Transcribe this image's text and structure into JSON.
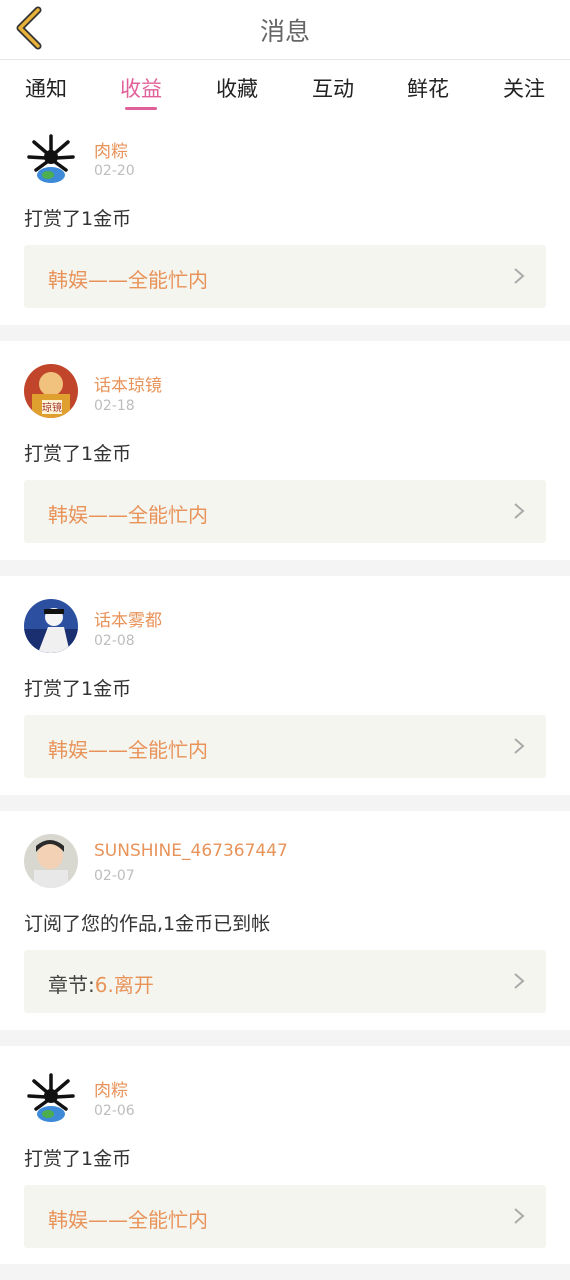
{
  "header": {
    "title": "消息",
    "back_icon": "chevron-left-icon",
    "accent_color": "#e8b13a"
  },
  "tabs": [
    {
      "label": "通知",
      "active": false
    },
    {
      "label": "收益",
      "active": true
    },
    {
      "label": "收藏",
      "active": false
    },
    {
      "label": "互动",
      "active": false
    },
    {
      "label": "鲜花",
      "active": false
    },
    {
      "label": "关注",
      "active": false
    }
  ],
  "colors": {
    "active_tab": "#e0609a",
    "username": "#e8935a",
    "link_bg": "#f5f5ef"
  },
  "messages": [
    {
      "username": "肉粽",
      "date": "02-20",
      "text": "打赏了1金币",
      "link_prefix": "",
      "link_text": "韩娱——全能忙内"
    },
    {
      "username": "话本琼镜",
      "date": "02-18",
      "text": "打赏了1金币",
      "link_prefix": "",
      "link_text": "韩娱——全能忙内"
    },
    {
      "username": "话本雾都",
      "date": "02-08",
      "text": "打赏了1金币",
      "link_prefix": "",
      "link_text": "韩娱——全能忙内"
    },
    {
      "username": "SUNSHINE_467367447",
      "date": "02-07",
      "text": "订阅了您的作品,1金币已到帐",
      "link_prefix": "章节:",
      "link_text": "6.离开"
    },
    {
      "username": "肉粽",
      "date": "02-06",
      "text": "打赏了1金币",
      "link_prefix": "",
      "link_text": "韩娱——全能忙内"
    }
  ]
}
